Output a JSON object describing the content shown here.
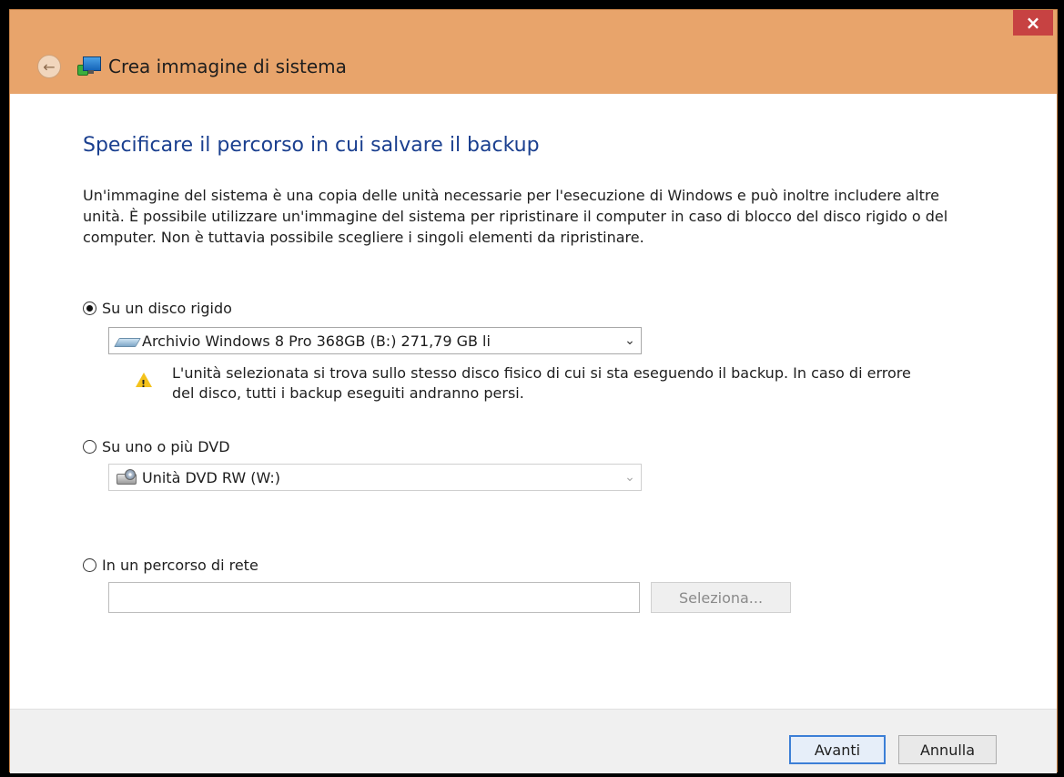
{
  "window": {
    "title": "Crea immagine di sistema",
    "close_glyph": "×"
  },
  "page": {
    "heading": "Specificare il percorso in cui salvare il backup",
    "description": "Un'immagine del sistema è una copia delle unità necessarie per l'esecuzione di Windows e può inoltre includere altre unità. È possibile utilizzare un'immagine del sistema per ripristinare il computer in caso di blocco del disco rigido o del computer. Non è tuttavia possibile scegliere i singoli elementi da ripristinare."
  },
  "options": {
    "hard_disk": {
      "label": "Su un disco rigido",
      "selected": true,
      "drive_value": "Archivio Windows 8 Pro 368GB (B:)  271,79 GB li",
      "warning": "L'unità selezionata si trova sullo stesso disco fisico di cui si sta eseguendo il backup. In caso di errore del disco, tutti i backup eseguiti andranno persi."
    },
    "dvd": {
      "label": "Su uno o più DVD",
      "selected": false,
      "drive_value": "Unità DVD RW (W:)"
    },
    "network": {
      "label": "In un percorso di rete",
      "selected": false,
      "path_value": "",
      "browse_label": "Seleziona..."
    }
  },
  "footer": {
    "next_label": "Avanti",
    "cancel_label": "Annulla"
  },
  "icons": {
    "back": "back-arrow-icon",
    "app": "system-image-icon",
    "hdd": "hard-drive-icon",
    "dvd": "dvd-drive-icon",
    "warning": "warning-icon",
    "dropdown": "chevron-down-icon"
  },
  "colors": {
    "frame": "#e8a46b",
    "close": "#c74242",
    "heading": "#1a3f8f",
    "primary_border": "#3c7fd6"
  }
}
